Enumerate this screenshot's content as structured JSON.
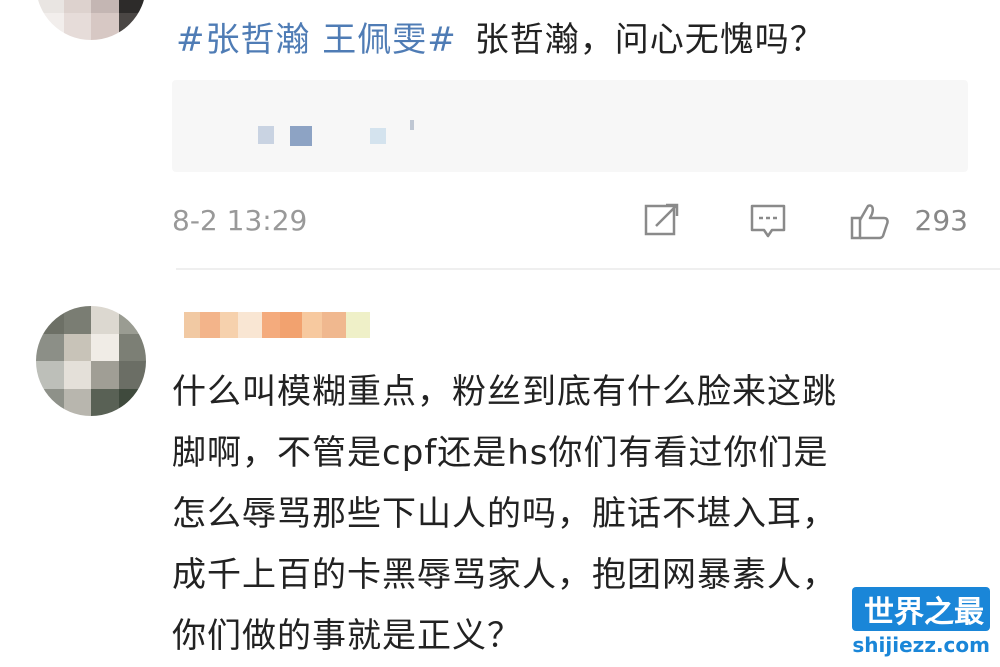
{
  "post": {
    "topic": "#张哲瀚 王佩雯#",
    "text": "张哲瀚，问心无愧吗？",
    "timestamp": "8-2 13:29",
    "like_count": "293",
    "icons": [
      "repost-icon",
      "comment-icon",
      "like-icon"
    ]
  },
  "comment": {
    "text": "什么叫模糊重点，粉丝到底有什么脸来这跳脚啊，不管是cpf还是hs你们有看过你们是怎么辱骂那些下山人的吗，脏话不堪入耳，成千上百的卡黑辱骂家人，抱团网暴素人，你们做的事就是正义？",
    "lines": [
      "什么叫模糊重点，粉丝到底有什么脸来这跳",
      "脚啊，不管是cpf还是hs你们有看过你们是",
      "怎么辱骂那些下山人的吗，脏话不堪入耳，",
      "成千上百的卡黑辱骂家人，抱团网暴素人，",
      "你们做的事就是正义？"
    ]
  },
  "watermark": {
    "title": "世界之最",
    "domain": "shijiezz.com"
  },
  "colors": {
    "hashtag": "#4f7cb5",
    "muted": "#999999",
    "watermark_blue": "#1a86d8"
  }
}
